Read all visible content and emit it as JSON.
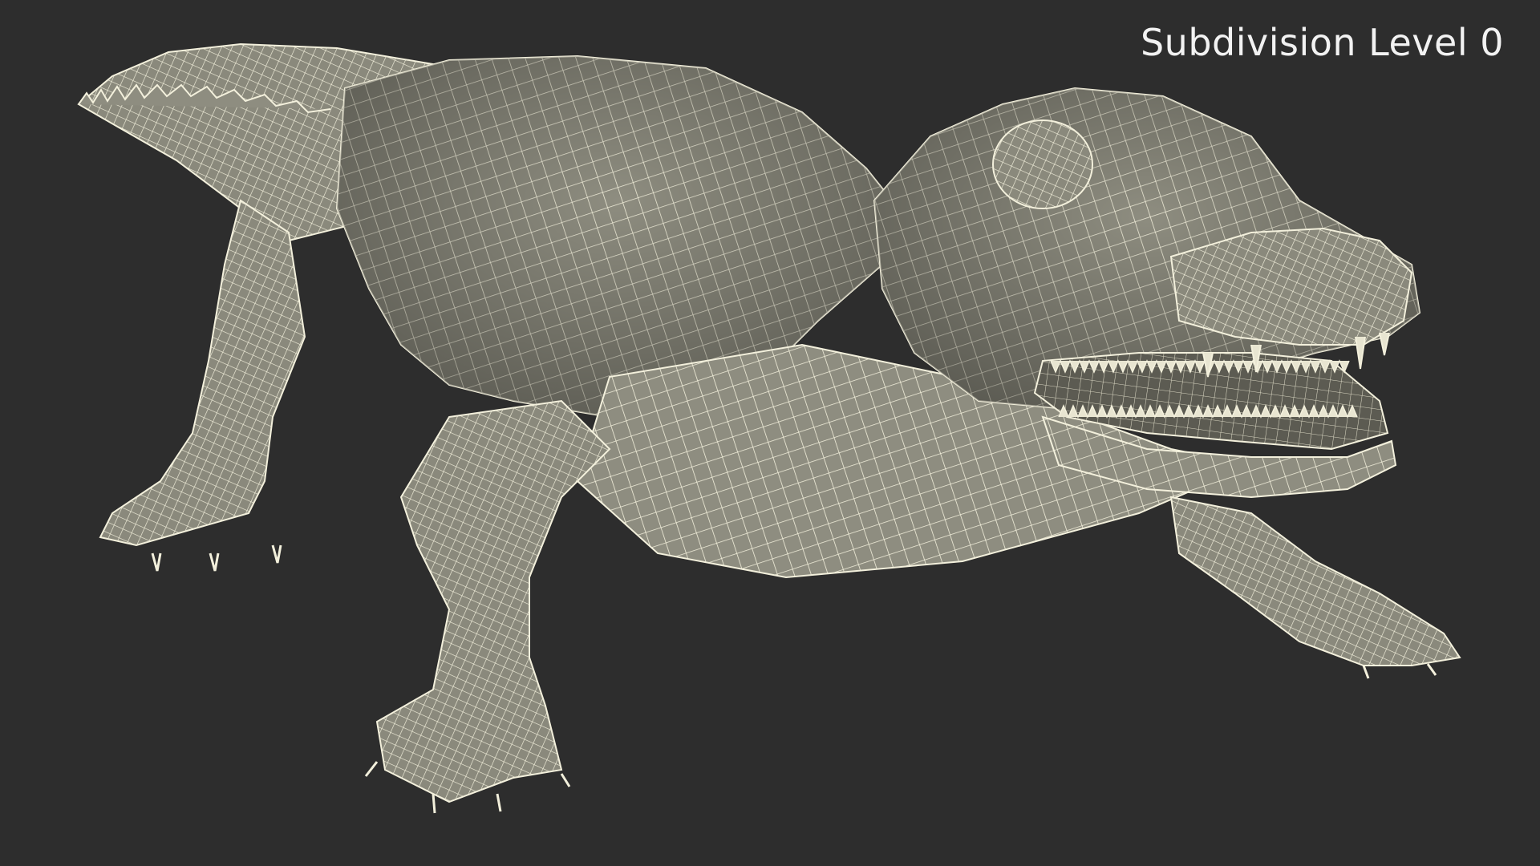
{
  "viewport": {
    "background": "#2d2d2d",
    "subdivision_label": "Subdivision Level 0"
  },
  "model": {
    "subject": "alligator",
    "display_mode": "wireframe-on-shaded",
    "surface_color": "#8e8d80",
    "wire_color": "#f3f0dc"
  }
}
